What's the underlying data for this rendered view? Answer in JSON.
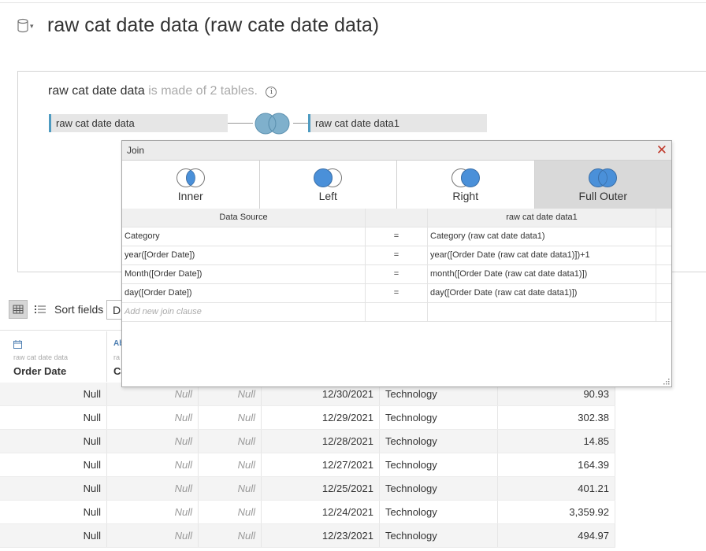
{
  "header": {
    "title": "raw cat date data (raw cate date data)",
    "datasource_icon": "cylinder-db-icon",
    "caret_icon": "chevron-down-icon"
  },
  "model": {
    "ds_name": "raw cat date data",
    "made_of": "is made of 2 tables.",
    "info_icon": "info-icon",
    "left_table": "raw cat date data",
    "right_table": "raw cat date data1",
    "join_icon": "full-outer-join-venn-icon"
  },
  "toolbar": {
    "grid_icon": "grid-view-icon",
    "list_icon": "list-view-icon",
    "sort_label": "Sort fields",
    "sort_value": "D"
  },
  "columns": [
    {
      "icon": "calendar-icon",
      "source": "raw cat date data",
      "name": "Order Date"
    },
    {
      "icon": "abc-string-icon",
      "source": "ra",
      "name": "Ca"
    }
  ],
  "rows": [
    [
      "Null",
      "Null",
      "Null",
      "12/30/2021",
      "Technology",
      "90.93"
    ],
    [
      "Null",
      "Null",
      "Null",
      "12/29/2021",
      "Technology",
      "302.38"
    ],
    [
      "Null",
      "Null",
      "Null",
      "12/28/2021",
      "Technology",
      "14.85"
    ],
    [
      "Null",
      "Null",
      "Null",
      "12/27/2021",
      "Technology",
      "164.39"
    ],
    [
      "Null",
      "Null",
      "Null",
      "12/25/2021",
      "Technology",
      "401.21"
    ],
    [
      "Null",
      "Null",
      "Null",
      "12/24/2021",
      "Technology",
      "3,359.92"
    ],
    [
      "Null",
      "Null",
      "Null",
      "12/23/2021",
      "Technology",
      "494.97"
    ]
  ],
  "join_dialog": {
    "title": "Join",
    "close_icon": "close-icon",
    "types": [
      {
        "label": "Inner",
        "icon": "inner-join-venn-icon",
        "selected": false
      },
      {
        "label": "Left",
        "icon": "left-join-venn-icon",
        "selected": false
      },
      {
        "label": "Right",
        "icon": "right-join-venn-icon",
        "selected": false
      },
      {
        "label": "Full Outer",
        "icon": "full-outer-join-venn-icon",
        "selected": true
      }
    ],
    "header_left": "Data Source",
    "header_right": "raw cat date data1",
    "clauses": [
      {
        "left": "Category",
        "op": "=",
        "right": "Category (raw cat date data1)"
      },
      {
        "left": "year([Order Date])",
        "op": "=",
        "right": "year([Order Date (raw cat date data1)])+1"
      },
      {
        "left": "Month([Order Date])",
        "op": "=",
        "right": "month([Order Date (raw cat date data1)])"
      },
      {
        "left": "day([Order Date])",
        "op": "=",
        "right": "day([Order Date (raw cat date data1)])"
      }
    ],
    "add_new": "Add new join clause",
    "resize_icon": "resize-grip-icon"
  },
  "colors": {
    "accent": "#4e9bc1",
    "venn_fill": "#4a90d9",
    "close": "#c0392b"
  }
}
